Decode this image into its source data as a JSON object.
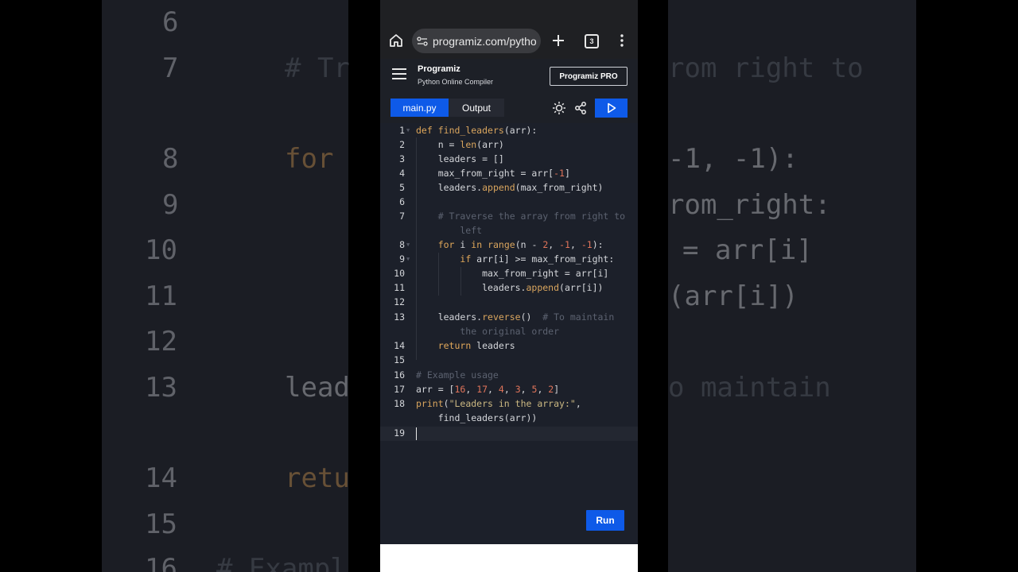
{
  "background": {
    "line_numbers": [
      "6",
      "7",
      "8",
      "9",
      "10",
      "11",
      "12",
      "13",
      "14",
      "15",
      "16"
    ],
    "fragments_left": [
      "# Tr",
      "for",
      "lead",
      "retu",
      "# Exampl"
    ],
    "fragments_right": [
      "rom right to",
      "-1, -1):",
      "rom_right:",
      "= arr[i]",
      "(arr[i])",
      "o maintain"
    ]
  },
  "browser": {
    "url": "programiz.com/pytho",
    "tab_count": "3",
    "icons": [
      "home-icon",
      "site-settings-icon",
      "new-tab-icon",
      "tab-switcher-icon",
      "more-icon"
    ]
  },
  "header": {
    "brand": "Programiz",
    "subtitle": "Python Online Compiler",
    "pro_button": "Programiz PRO"
  },
  "toolbar": {
    "tab_main": "main.py",
    "tab_output": "Output"
  },
  "editor": {
    "line_numbers": [
      "1",
      "2",
      "3",
      "4",
      "5",
      "6",
      "7",
      "8",
      "9",
      "10",
      "11",
      "12",
      "13",
      "14",
      "15",
      "16",
      "17",
      "18",
      "19"
    ]
  },
  "run_button": "Run",
  "colors": {
    "accent": "#0e5ae8",
    "editor_bg": "#1c202a",
    "keyword": "#e1a85a",
    "number": "#e0745a",
    "comment": "#5c6270"
  }
}
